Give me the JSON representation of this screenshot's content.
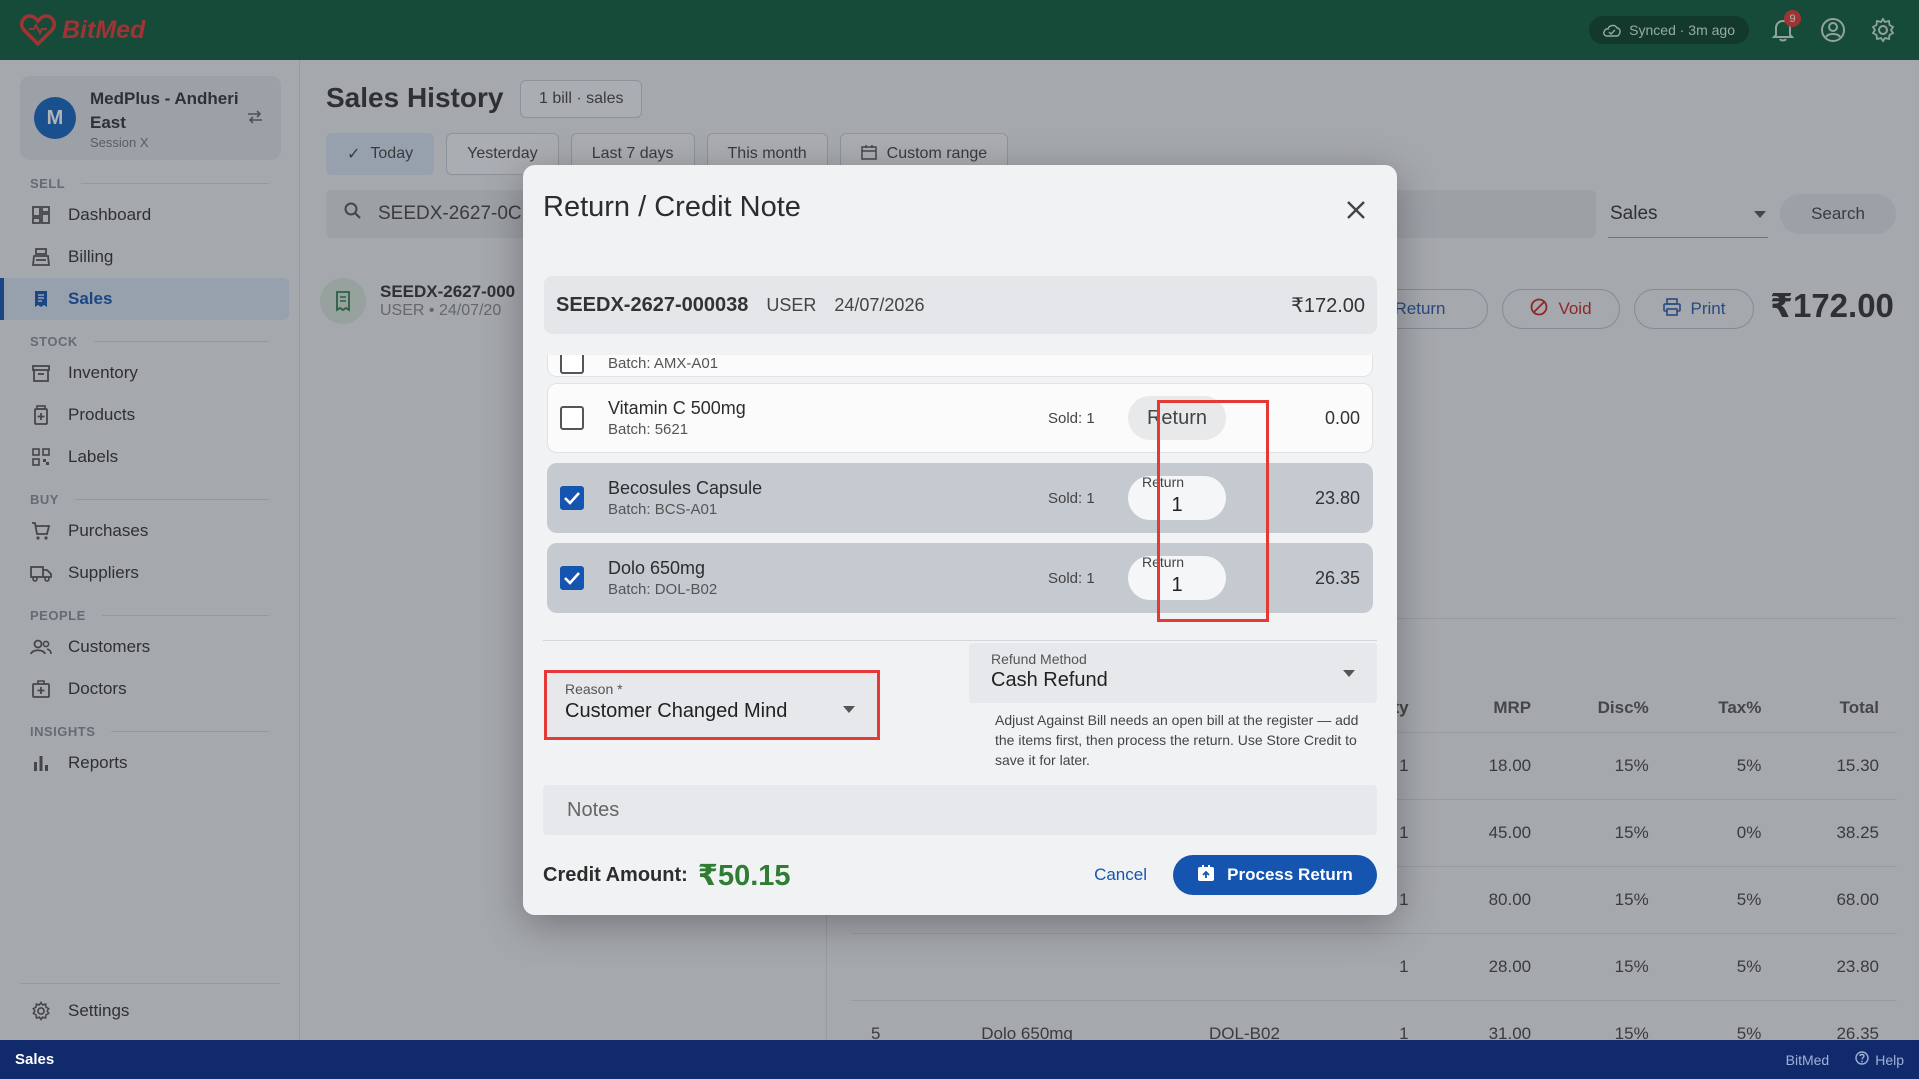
{
  "app": {
    "logo_text": "BitMed",
    "sync_status": "Synced · 3m ago",
    "notification_count": "9",
    "colors": {
      "topbar": "#0d5c3c",
      "accent": "#1555b0",
      "credit": "#2e7d32",
      "highlight": "#e53935",
      "statusbar": "#102a6b"
    }
  },
  "sidebar": {
    "store_initial": "M",
    "store_name": "MedPlus - Andheri East",
    "session": "Session X",
    "sections": {
      "sell": "SELL",
      "stock": "STOCK",
      "buy": "BUY",
      "people": "PEOPLE",
      "insights": "INSIGHTS"
    },
    "items": {
      "dashboard": "Dashboard",
      "billing": "Billing",
      "sales": "Sales",
      "inventory": "Inventory",
      "products": "Products",
      "labels": "Labels",
      "purchases": "Purchases",
      "suppliers": "Suppliers",
      "customers": "Customers",
      "doctors": "Doctors",
      "reports": "Reports",
      "settings": "Settings"
    }
  },
  "main": {
    "title": "Sales History",
    "bill_chip": "1 bill · sales",
    "filters": {
      "today": "Today",
      "yesterday": "Yesterday",
      "last7": "Last 7 days",
      "month": "This month",
      "custom": "Custom range"
    },
    "search_value": "SEEDX-2627-0C",
    "type_select": "Sales",
    "search_button": "Search",
    "sale": {
      "id": "SEEDX-2627-000",
      "sub": "USER • 24/07/20"
    },
    "actions": {
      "return": "Return",
      "void": "Void",
      "print": "Print"
    },
    "total": "₹172.00",
    "table": {
      "headers": [
        "ty",
        "MRP",
        "Disc%",
        "Tax%",
        "Total"
      ],
      "rows": [
        {
          "idx": "",
          "name": "",
          "batch": "",
          "qty": "1",
          "mrp": "18.00",
          "disc": "15%",
          "tax": "5%",
          "total": "15.30"
        },
        {
          "idx": "",
          "name": "",
          "batch": "",
          "qty": "1",
          "mrp": "45.00",
          "disc": "15%",
          "tax": "0%",
          "total": "38.25"
        },
        {
          "idx": "",
          "name": "",
          "batch": "",
          "qty": "1",
          "mrp": "80.00",
          "disc": "15%",
          "tax": "5%",
          "total": "68.00"
        },
        {
          "idx": "",
          "name": "",
          "batch": "",
          "qty": "1",
          "mrp": "28.00",
          "disc": "15%",
          "tax": "5%",
          "total": "23.80"
        },
        {
          "idx": "5",
          "name": "Dolo 650mg",
          "batch": "DOL-B02",
          "qty": "1",
          "mrp": "31.00",
          "disc": "15%",
          "tax": "5%",
          "total": "26.35"
        }
      ]
    }
  },
  "statusbar": {
    "left": "Sales",
    "brand": "BitMed",
    "help": "Help"
  },
  "modal": {
    "title": "Return / Credit Note",
    "bill": {
      "id": "SEEDX-2627-000038",
      "user": "USER",
      "date": "24/07/2026",
      "amount": "₹172.00"
    },
    "partial_item_batch": "Batch: AMX-A01",
    "items": [
      {
        "name": "Vitamin C 500mg",
        "batch": "Batch: 5621",
        "sold": "Sold: 1",
        "return_label": "Return",
        "return_qty": "",
        "checked": false,
        "amount": "0.00"
      },
      {
        "name": "Becosules Capsule",
        "batch": "Batch: BCS-A01",
        "sold": "Sold: 1",
        "return_label": "Return",
        "return_qty": "1",
        "checked": true,
        "amount": "23.80"
      },
      {
        "name": "Dolo 650mg",
        "batch": "Batch: DOL-B02",
        "sold": "Sold: 1",
        "return_label": "Return",
        "return_qty": "1",
        "checked": true,
        "amount": "26.35"
      }
    ],
    "reason_label": "Reason *",
    "reason_value": "Customer Changed Mind",
    "refund_label": "Refund Method",
    "refund_value": "Cash Refund",
    "refund_help": "Adjust Against Bill needs an open bill at the register — add the items first, then process the return. Use Store Credit to save it for later.",
    "notes_placeholder": "Notes",
    "credit_label": "Credit Amount:",
    "credit_amount": "₹50.15",
    "cancel": "Cancel",
    "process": "Process Return"
  }
}
